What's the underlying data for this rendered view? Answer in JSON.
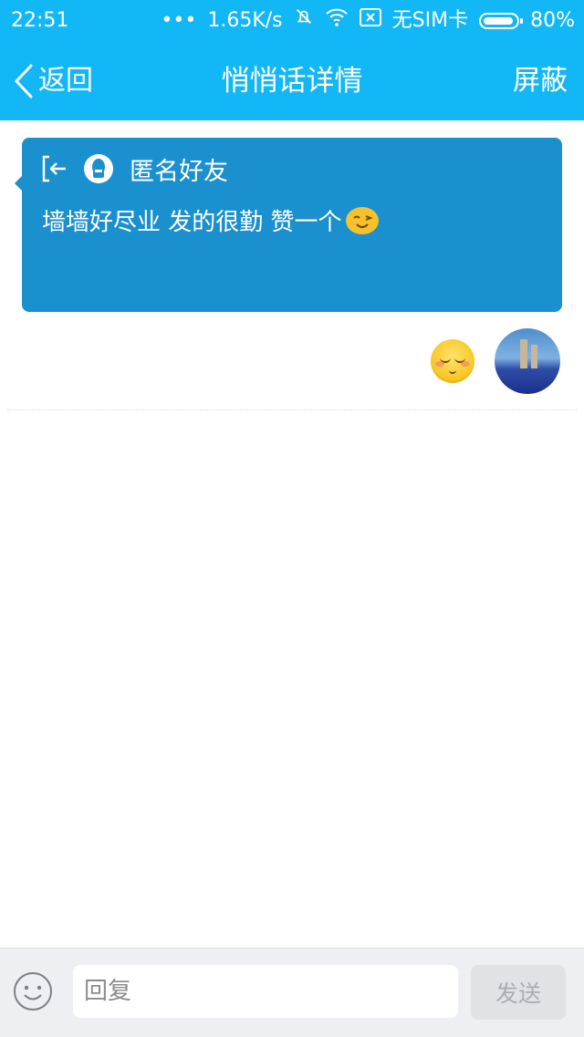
{
  "status_bar": {
    "time": "22:51",
    "network_speed": "1.65K/s",
    "sim": "无SIM卡",
    "battery": "80%"
  },
  "nav": {
    "back_label": "返回",
    "title": "悄悄话详情",
    "right_action": "屏蔽"
  },
  "card": {
    "sender": "匿名好友",
    "message": "墙墙好尽业 发的很勤 赞一个",
    "color": "#1A90CE"
  },
  "reply": {
    "placeholder": "回复",
    "send_label": "发送"
  },
  "colors": {
    "header": "#12B7F5"
  }
}
